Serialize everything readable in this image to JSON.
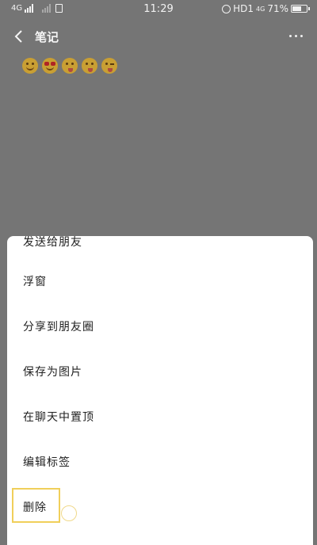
{
  "status_bar": {
    "network": "4G",
    "time": "11:29",
    "hd": "HD1",
    "net_small": "4G",
    "battery": "71%",
    "battery_level": 0.71
  },
  "header": {
    "title": "笔记"
  },
  "note": {
    "emojis": [
      "smile-emoji",
      "heart-eyes-emoji",
      "tongue-emoji",
      "tongue-emoji",
      "wink-tongue-emoji"
    ]
  },
  "menu": {
    "items": [
      {
        "label": "发送给朋友"
      },
      {
        "label": "浮窗"
      },
      {
        "label": "分享到朋友圈"
      },
      {
        "label": "保存为图片"
      },
      {
        "label": "在聊天中置顶"
      },
      {
        "label": "编辑标签"
      },
      {
        "label": "删除"
      }
    ]
  },
  "colors": {
    "overlay": "#757575",
    "sheet": "#ffffff",
    "highlight": "#f0cf5a"
  }
}
